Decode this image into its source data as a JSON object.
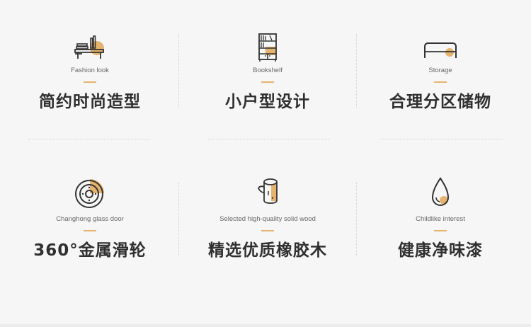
{
  "accent_color": "#e6b36f",
  "features": [
    {
      "icon": "desk-icon",
      "en": "Fashion look",
      "cn": "简约时尚造型"
    },
    {
      "icon": "bookshelf-icon",
      "en": "Bookshelf",
      "cn": "小户型设计"
    },
    {
      "icon": "storage-icon",
      "en": "Storage",
      "cn": "合理分区储物"
    },
    {
      "icon": "wheel-icon",
      "en": "Changhong glass door",
      "cn": "360°金属滑轮"
    },
    {
      "icon": "wood-log-icon",
      "en": "Selected high-quality solid wood",
      "cn": "精选优质橡胶木"
    },
    {
      "icon": "drop-icon",
      "en": "Childlike interest",
      "cn": "健康净味漆"
    }
  ]
}
